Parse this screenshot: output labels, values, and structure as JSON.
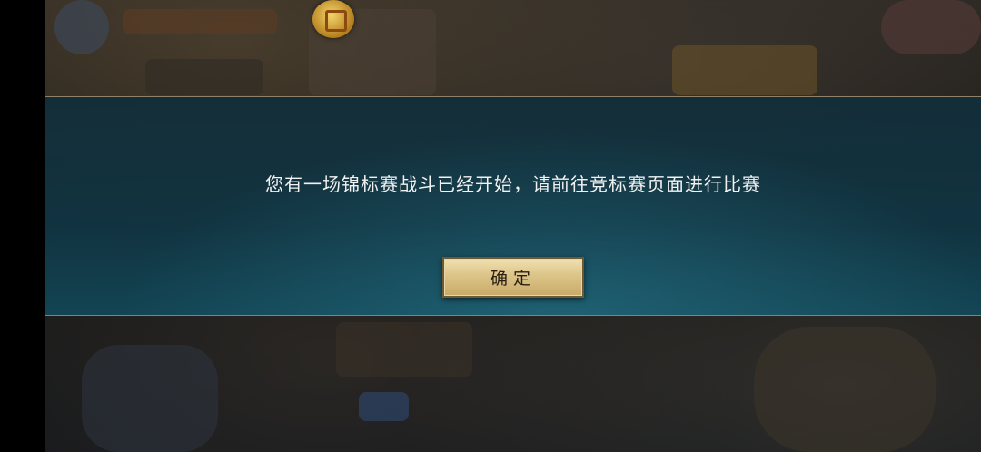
{
  "dialog": {
    "message": "您有一场锦标赛战斗已经开始，请前往竞标赛页面进行比赛",
    "confirm_label": "确定"
  }
}
